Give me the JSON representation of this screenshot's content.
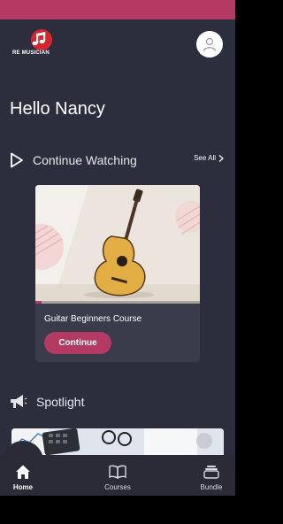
{
  "app": {
    "logo_text": "RE MUSICIAN",
    "accent": "#b23a63",
    "background": "#2c2e3d"
  },
  "greeting": "Hello Nancy",
  "continue_watching": {
    "title": "Continue Watching",
    "see_all": "See All",
    "icon": "play-outline-icon",
    "course": {
      "title": "Guitar Beginners Course",
      "button": "Continue",
      "progress": 0.04
    }
  },
  "spotlight": {
    "title": "Spotlight",
    "icon": "megaphone-icon"
  },
  "nav": [
    {
      "label": "Home",
      "icon": "home-icon",
      "active": true
    },
    {
      "label": "Courses",
      "icon": "book-icon",
      "active": false
    },
    {
      "label": "Bundle",
      "icon": "stack-icon",
      "active": false
    }
  ]
}
